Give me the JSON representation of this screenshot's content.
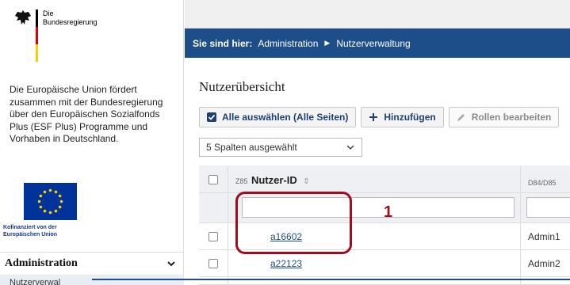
{
  "logo": {
    "line1": "Die",
    "line2": "Bundesregierung"
  },
  "sidebar": {
    "eu_text": "Die Europäische Union fördert zusammen mit der Bundesregierung über den Europäischen Sozialfonds Plus (ESF Plus) Programme und Vorhaben in Deutschland.",
    "eu_caption_line1": "Kofinanziert von der",
    "eu_caption_line2": "Europäischen Union",
    "nav_section": "Administration",
    "nav_sub": "Nutzerverwal"
  },
  "breadcrumb": {
    "lead": "Sie sind hier:",
    "items": [
      "Administration",
      "Nutzerverwaltung"
    ]
  },
  "page_title": "Nutzerübersicht",
  "toolbar": {
    "select_all": "Alle auswählen (Alle Seiten)",
    "add": "Hinzufügen",
    "edit_roles": "Rollen bearbeiten"
  },
  "columns_select": "5 Spalten ausgewählt",
  "table": {
    "col1_prefix": "Z85",
    "col1_label": "Nutzer-ID",
    "col2_prefix": "D84/D85",
    "rows": [
      {
        "id": "a16602",
        "role": "Admin1"
      },
      {
        "id": "a22123",
        "role": "Admin2"
      }
    ]
  },
  "annotation_number": "1",
  "colors": {
    "brand_blue": "#1d4e89",
    "highlight_red": "#a10b1f"
  },
  "icons": [
    "eagle-icon",
    "checkbox-checked-icon",
    "plus-icon",
    "pencil-icon",
    "chevron-down-icon",
    "sort-icon",
    "eu-flag-icon"
  ]
}
